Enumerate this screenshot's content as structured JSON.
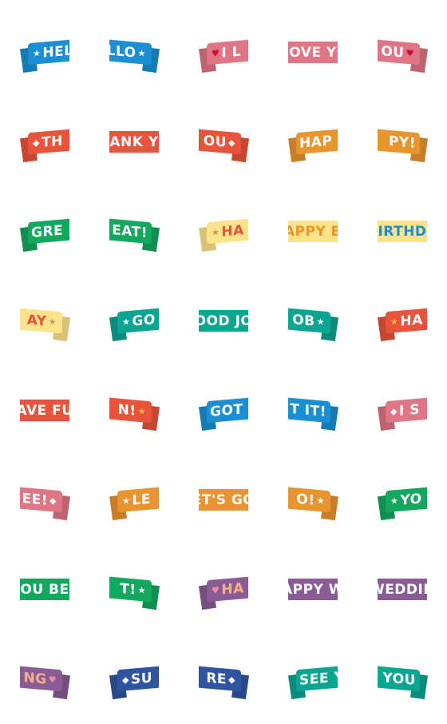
{
  "colors": {
    "blue": "#1a8fd4",
    "pink": "#e07585",
    "red": "#e8533b",
    "orange": "#e9952f",
    "green": "#14a85f",
    "yellow": "#fde48a",
    "teal": "#0ba592",
    "purple": "#8a5c96",
    "navy": "#2f55a0"
  },
  "stickers": [
    {
      "text": "HEL",
      "icon": "★",
      "icon_pos": "before",
      "piece": "left",
      "color": "blue",
      "text_color": "#ffffff"
    },
    {
      "text": "LLO",
      "icon": "★",
      "icon_pos": "after",
      "piece": "right",
      "color": "blue",
      "text_color": "#ffffff"
    },
    {
      "text": "I L",
      "icon": "♥",
      "icon_pos": "before",
      "piece": "left",
      "color": "pink",
      "text_color": "#ffffff",
      "icon_color": "#c8102e"
    },
    {
      "text": "OVE Y",
      "icon": "",
      "piece": "mid",
      "color": "pink",
      "text_color": "#ffffff"
    },
    {
      "text": "OU",
      "icon": "♥",
      "icon_pos": "after",
      "piece": "right",
      "color": "pink",
      "text_color": "#ffffff",
      "icon_color": "#c8102e"
    },
    {
      "text": "TH",
      "icon": "◆",
      "icon_pos": "before",
      "piece": "left",
      "color": "red",
      "text_color": "#ffffff"
    },
    {
      "text": "ANK Y",
      "icon": "",
      "piece": "mid",
      "color": "red",
      "text_color": "#ffffff"
    },
    {
      "text": "OU",
      "icon": "◆",
      "icon_pos": "after",
      "piece": "right",
      "color": "red",
      "text_color": "#ffffff"
    },
    {
      "text": "HAP",
      "icon": "",
      "piece": "left",
      "color": "orange",
      "text_color": "#ffffff"
    },
    {
      "text": "PY!",
      "icon": "",
      "piece": "right",
      "color": "orange",
      "text_color": "#ffffff"
    },
    {
      "text": "GRE",
      "icon": "",
      "piece": "left",
      "color": "green",
      "text_color": "#ffffff"
    },
    {
      "text": "EAT!",
      "icon": "",
      "piece": "right",
      "color": "green",
      "text_color": "#ffffff"
    },
    {
      "text": "HA",
      "icon": "★",
      "icon_pos": "before",
      "piece": "left",
      "color": "yellow",
      "text_color": "#e8533b",
      "icon_color": "#b89a6a"
    },
    {
      "text": "APPY B",
      "icon": "",
      "piece": "mid",
      "color": "yellow",
      "text_color": "#e9952f"
    },
    {
      "text": "IRTHD",
      "icon": "",
      "piece": "mid",
      "color": "yellow",
      "text_color": "#1a8fd4"
    },
    {
      "text": "AY",
      "icon": "★",
      "icon_pos": "after",
      "piece": "right",
      "color": "yellow",
      "text_color": "#e8533b",
      "icon_color": "#b89a6a"
    },
    {
      "text": "GO",
      "icon": "★",
      "icon_pos": "before",
      "piece": "left",
      "color": "teal",
      "text_color": "#ffffff"
    },
    {
      "text": "OOD JO",
      "icon": "",
      "piece": "mid",
      "color": "teal",
      "text_color": "#ffffff"
    },
    {
      "text": "OB",
      "icon": "★",
      "icon_pos": "after",
      "piece": "right",
      "color": "teal",
      "text_color": "#ffffff"
    },
    {
      "text": "HA",
      "icon": "★",
      "icon_pos": "before",
      "piece": "left",
      "color": "red",
      "text_color": "#ffffff",
      "icon_color": "#f6b73c"
    },
    {
      "text": "AVE FU",
      "icon": "",
      "piece": "mid",
      "color": "red",
      "text_color": "#ffffff"
    },
    {
      "text": "N!",
      "icon": "★",
      "icon_pos": "after",
      "piece": "right",
      "color": "red",
      "text_color": "#ffffff",
      "icon_color": "#f6b73c"
    },
    {
      "text": "GOT",
      "icon": "",
      "piece": "left",
      "color": "blue",
      "text_color": "#ffffff"
    },
    {
      "text": "T IT!",
      "icon": "",
      "piece": "right",
      "color": "blue",
      "text_color": "#ffffff"
    },
    {
      "text": "I S",
      "icon": "◆",
      "icon_pos": "before",
      "piece": "left",
      "color": "pink",
      "text_color": "#ffffff"
    },
    {
      "text": "EE!",
      "icon": "◆",
      "icon_pos": "after",
      "piece": "right",
      "color": "pink",
      "text_color": "#ffffff"
    },
    {
      "text": "LE",
      "icon": "★",
      "icon_pos": "before",
      "piece": "left",
      "color": "orange",
      "text_color": "#ffffff"
    },
    {
      "text": "ET'S GO",
      "icon": "",
      "piece": "mid",
      "color": "orange",
      "text_color": "#ffffff"
    },
    {
      "text": "O!",
      "icon": "★",
      "icon_pos": "after",
      "piece": "right",
      "color": "orange",
      "text_color": "#ffffff"
    },
    {
      "text": "YO",
      "icon": "★",
      "icon_pos": "before",
      "piece": "left",
      "color": "green",
      "text_color": "#ffffff"
    },
    {
      "text": "OU BE",
      "icon": "",
      "piece": "mid",
      "color": "green",
      "text_color": "#ffffff"
    },
    {
      "text": "T!",
      "icon": "★",
      "icon_pos": "after",
      "piece": "right",
      "color": "green",
      "text_color": "#ffffff"
    },
    {
      "text": "HA",
      "icon": "♥",
      "icon_pos": "before",
      "piece": "left",
      "color": "purple",
      "text_color": "#f7b08a",
      "icon_color": "#f08aa0"
    },
    {
      "text": "APPY W",
      "icon": "",
      "piece": "mid",
      "color": "purple",
      "text_color": "#ffffff"
    },
    {
      "text": "WEDDIN",
      "icon": "",
      "piece": "mid",
      "color": "purple",
      "text_color": "#ffffff"
    },
    {
      "text": "NG",
      "icon": "♥",
      "icon_pos": "after",
      "piece": "right",
      "color": "purple",
      "text_color": "#f7b08a",
      "icon_color": "#f08aa0"
    },
    {
      "text": "SU",
      "icon": "◆",
      "icon_pos": "before",
      "piece": "left",
      "color": "navy",
      "text_color": "#ffffff"
    },
    {
      "text": "RE",
      "icon": "◆",
      "icon_pos": "after",
      "piece": "right",
      "color": "navy",
      "text_color": "#ffffff"
    },
    {
      "text": "SEE Y",
      "icon": "",
      "piece": "left",
      "color": "teal",
      "text_color": "#ffffff"
    },
    {
      "text": "YOU",
      "icon": "",
      "piece": "right",
      "color": "teal",
      "text_color": "#ffffff"
    }
  ]
}
